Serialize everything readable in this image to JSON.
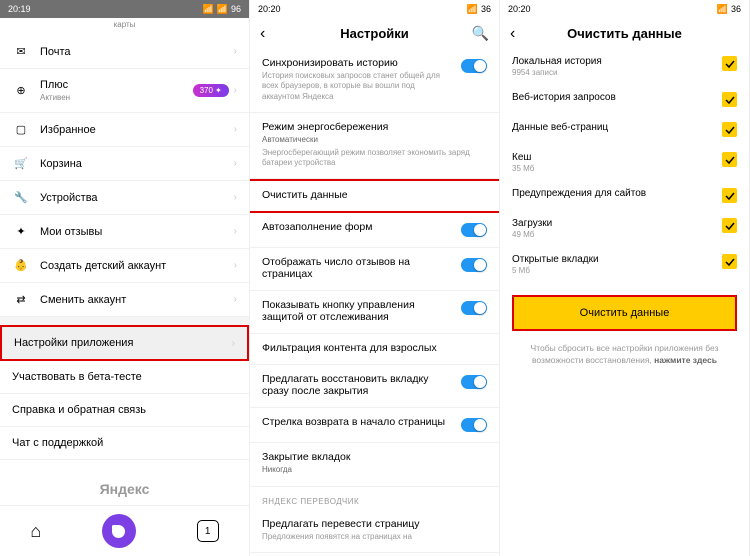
{
  "panel1": {
    "time": "20:19",
    "battery": "96",
    "top_label": "карты",
    "items": [
      {
        "icon": "mail",
        "label": "Почта"
      },
      {
        "icon": "plus-circle",
        "label": "Плюс",
        "sub": "Активен",
        "badge": "370"
      },
      {
        "icon": "bookmark",
        "label": "Избранное"
      },
      {
        "icon": "cart",
        "label": "Корзина"
      },
      {
        "icon": "wrench",
        "label": "Устройства"
      },
      {
        "icon": "star",
        "label": "Мои отзывы"
      },
      {
        "icon": "child",
        "label": "Создать детский аккаунт"
      },
      {
        "icon": "switch",
        "label": "Сменить аккаунт"
      }
    ],
    "bottom_items": [
      {
        "label": "Настройки приложения",
        "highlight": true
      },
      {
        "label": "Участвовать в бета-тесте"
      },
      {
        "label": "Справка и обратная связь"
      },
      {
        "label": "Чат с поддержкой"
      }
    ],
    "brand": "Яндекс",
    "tab_count": "1"
  },
  "panel2": {
    "time": "20:20",
    "battery": "36",
    "title": "Настройки",
    "items": [
      {
        "title": "Синхронизировать историю",
        "desc": "История поисковых запросов станет общей для всех браузеров, в которые вы вошли под аккаунтом Яндекса",
        "toggle": true
      },
      {
        "title": "Режим энергосбережения",
        "sub": "Автоматически",
        "desc": "Энергосберегающий режим позволяет экономить заряд батареи устройства"
      },
      {
        "title": "Очистить данные",
        "highlight": true
      },
      {
        "title": "Автозаполнение форм",
        "toggle": true
      },
      {
        "title": "Отображать число отзывов на страницах",
        "toggle": true
      },
      {
        "title": "Показывать кнопку управления защитой от отслеживания",
        "toggle": true
      },
      {
        "title": "Фильтрация контента для взрослых"
      },
      {
        "title": "Предлагать восстановить вкладку сразу после закрытия",
        "toggle": true
      },
      {
        "title": "Стрелка возврата в начало страницы",
        "toggle": true
      },
      {
        "title": "Закрытие вкладок",
        "sub": "Никогда"
      }
    ],
    "section": "ЯНДЕКС ПЕРЕВОДЧИК",
    "last_item": {
      "title": "Предлагать перевести страницу",
      "desc": "Предложения появятся на страницах на"
    }
  },
  "panel3": {
    "time": "20:20",
    "battery": "36",
    "title": "Очистить данные",
    "items": [
      {
        "title": "Локальная история",
        "sub": "9954 записи"
      },
      {
        "title": "Веб-история запросов"
      },
      {
        "title": "Данные веб-страниц"
      },
      {
        "title": "Кеш",
        "sub": "35 Мб"
      },
      {
        "title": "Предупреждения для сайтов"
      },
      {
        "title": "Загрузки",
        "sub": "49 Мб"
      },
      {
        "title": "Открытые вкладки",
        "sub": "5 Мб"
      }
    ],
    "button": "Очистить данные",
    "note_part1": "Чтобы сбросить все настройки приложения без возможности восстановления, ",
    "note_bold": "нажмите здесь"
  }
}
